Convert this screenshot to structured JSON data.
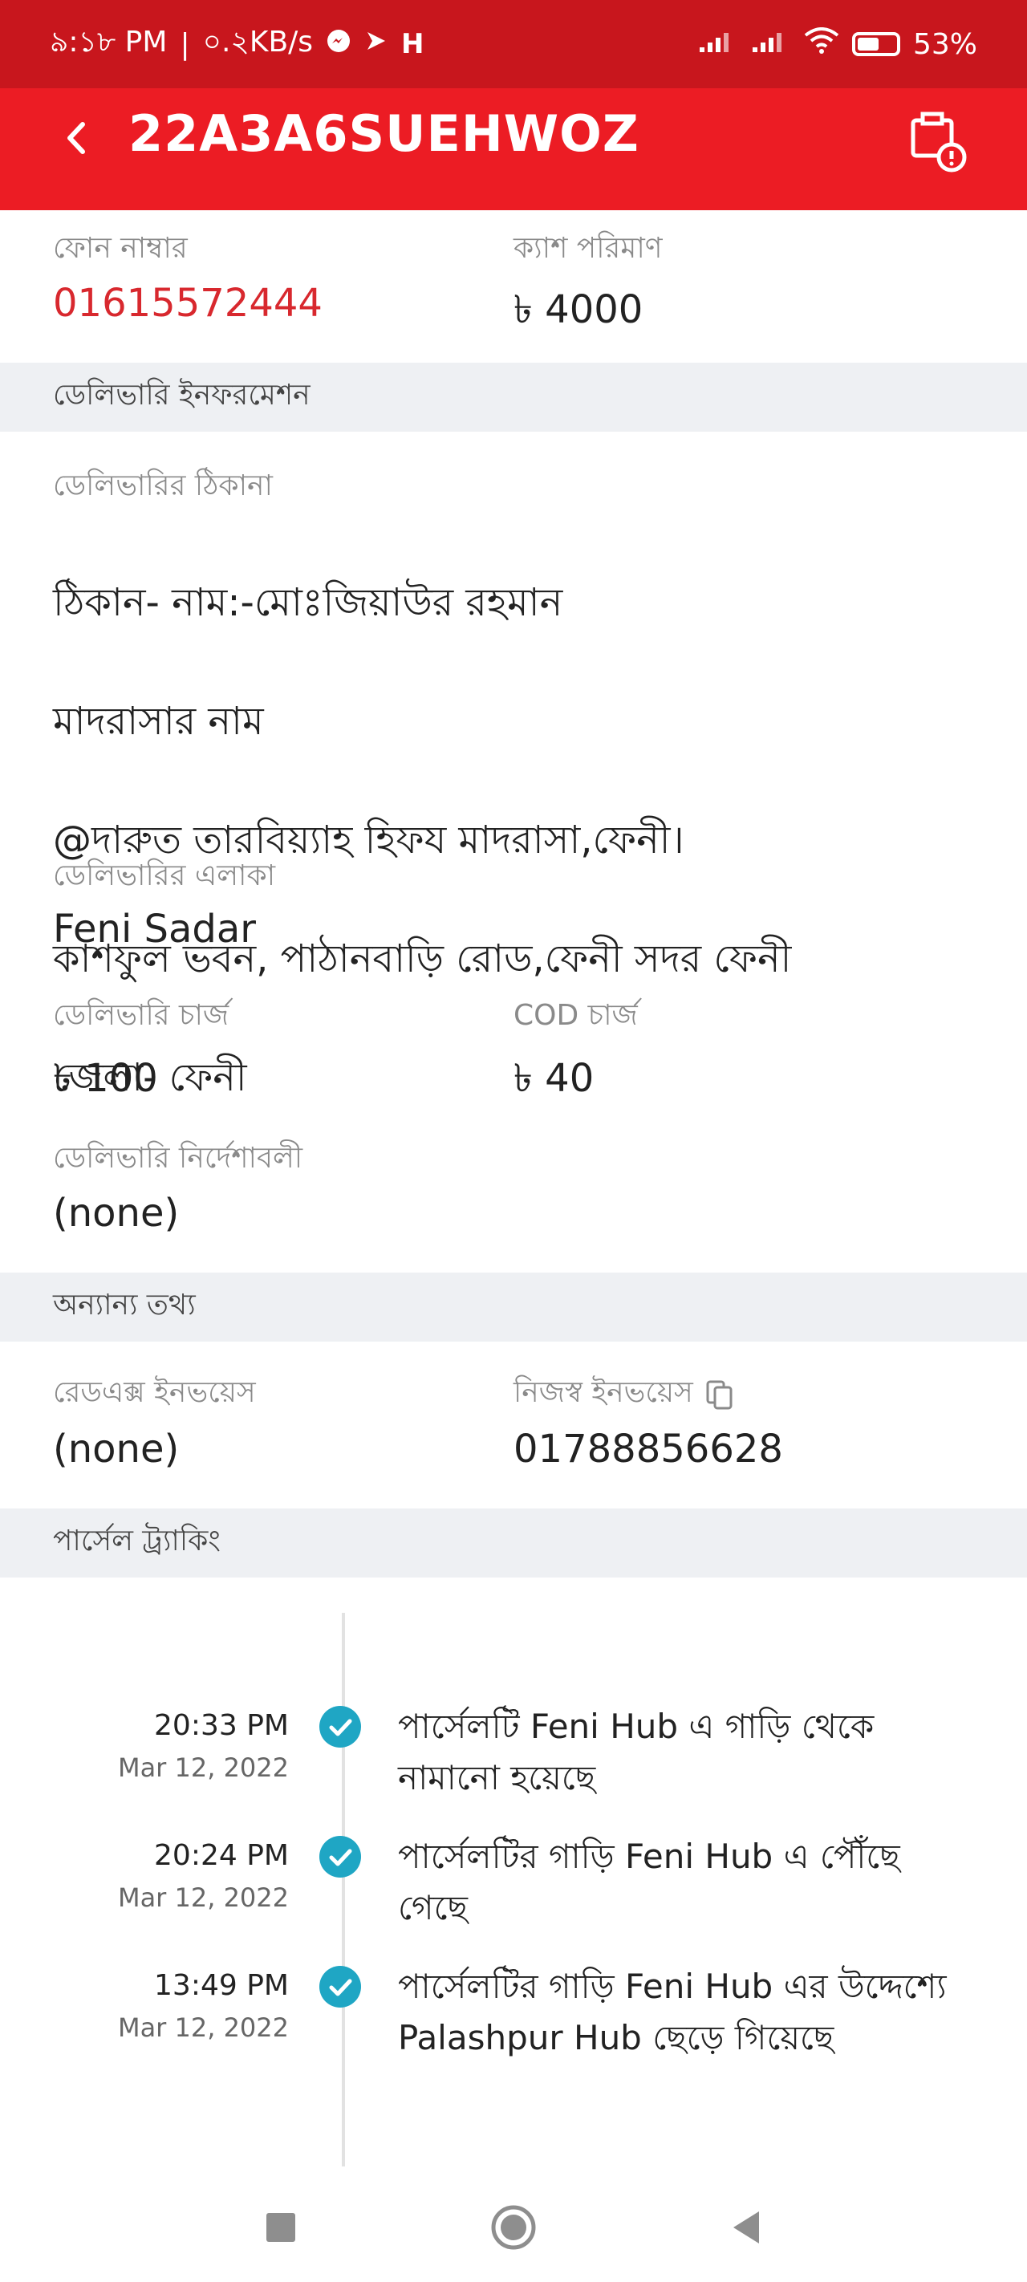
{
  "status_bar": {
    "time": "৯:১৮ PM",
    "speed": "০.২KB/s",
    "battery": "53%"
  },
  "app_bar": {
    "title": "22A3A6SUEHWOZ"
  },
  "summary": {
    "phone_label": "ফোন নাম্বার",
    "phone_value": "01615572444",
    "cash_label": "ক্যাশ পরিমাণ",
    "cash_value": "৳ 4000"
  },
  "delivery_info": {
    "section_title": "ডেলিভারি ইনফরমেশন",
    "address_label": "ডেলিভারির ঠিকানা",
    "address_lines": [
      "ঠিকান- নাম:-মোঃজিয়াউর রহমান",
      "মাদরাসার নাম",
      "@দারুত তারবিয়্যাহ হিফয মাদরাসা,ফেনী।",
      "কাশফুল ভবন, পাঠানবাড়ি রোড,ফেনী সদর ফেনী",
      "জেলা- ফেনী"
    ],
    "area_label": "ডেলিভারির এলাকা",
    "area_value": "Feni Sadar",
    "delivery_charge_label": "ডেলিভারি চার্জ",
    "delivery_charge_value": "৳ 100",
    "cod_charge_label": "COD চার্জ",
    "cod_charge_value": "৳ 40",
    "instructions_label": "ডেলিভারি নির্দেশাবলী",
    "instructions_value": "(none)"
  },
  "other_info": {
    "section_title": "অন্যান্য তথ্য",
    "redx_invoice_label": "রেডএক্স ইনভয়েস",
    "redx_invoice_value": "(none)",
    "own_invoice_label": "নিজস্ব ইনভয়েস",
    "own_invoice_value": "01788856628"
  },
  "tracking": {
    "section_title": "পার্সেল ট্র্যাকিং",
    "events": [
      {
        "time": "20:33 PM",
        "date": "Mar 12, 2022",
        "text": "পার্সেলটি Feni Hub এ গাড়ি থেকে নামানো হয়েছে"
      },
      {
        "time": "20:24 PM",
        "date": "Mar 12, 2022",
        "text": "পার্সেলটির গাড়ি Feni Hub এ পৌঁছে গেছে"
      },
      {
        "time": "13:49 PM",
        "date": "Mar 12, 2022",
        "text": "পার্সেলটির গাড়ি Feni Hub এর উদ্দেশ্যে Palashpur Hub ছেড়ে গিয়েছে"
      }
    ]
  },
  "colors": {
    "status_bar": "#c8161d",
    "app_bar": "#ec1c24",
    "check": "#1fa6c4",
    "phone": "#d8282e"
  }
}
